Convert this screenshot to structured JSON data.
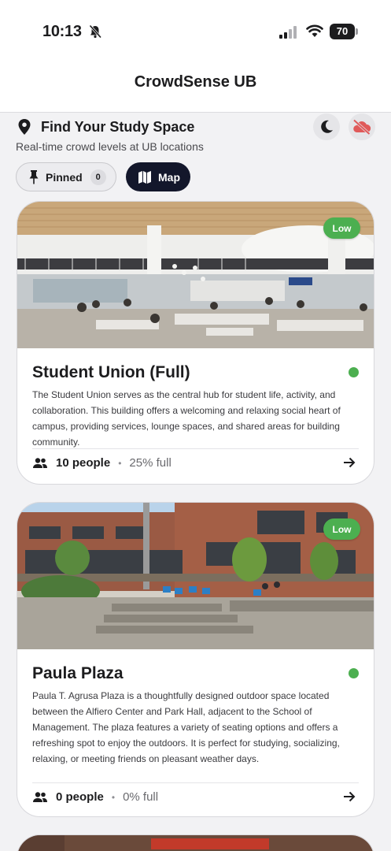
{
  "status_bar": {
    "time": "10:13",
    "battery_level": "70",
    "icons": [
      "bell-slash-icon",
      "signal-icon",
      "wifi-icon",
      "battery-icon"
    ]
  },
  "header": {
    "title": "CrowdSense UB"
  },
  "page": {
    "title": "Find Your Study Space",
    "subtitle": "Real-time crowd levels at UB locations",
    "icons": [
      "location-pin-icon",
      "moon-icon",
      "cloud-off-icon"
    ]
  },
  "filters": {
    "pinned_label": "Pinned",
    "pinned_count": "0",
    "map_label": "Map"
  },
  "colors": {
    "accent_dark": "#13172b",
    "status_green": "#4caf50",
    "cloud_off_red": "#e05a5a"
  },
  "locations": [
    {
      "name": "Student Union (Full)",
      "level": "Low",
      "description": "The Student Union serves as the central hub for student life, activity, and collaboration. This building offers a welcoming and relaxing social heart of campus, providing services, lounge spaces, and shared areas for building community.",
      "people": "10 people",
      "fullness": "25% full",
      "separator": "•"
    },
    {
      "name": "Paula Plaza",
      "level": "Low",
      "description": "Paula T. Agrusa Plaza is a thoughtfully designed outdoor space located between the Alfiero Center and Park Hall, adjacent to the School of Management. The plaza features a variety of seating options and offers a refreshing spot to enjoy the outdoors. It is perfect for studying, socializing, relaxing, or meeting friends on pleasant weather days.",
      "people": "0 people",
      "fullness": "0% full",
      "separator": "•"
    }
  ]
}
